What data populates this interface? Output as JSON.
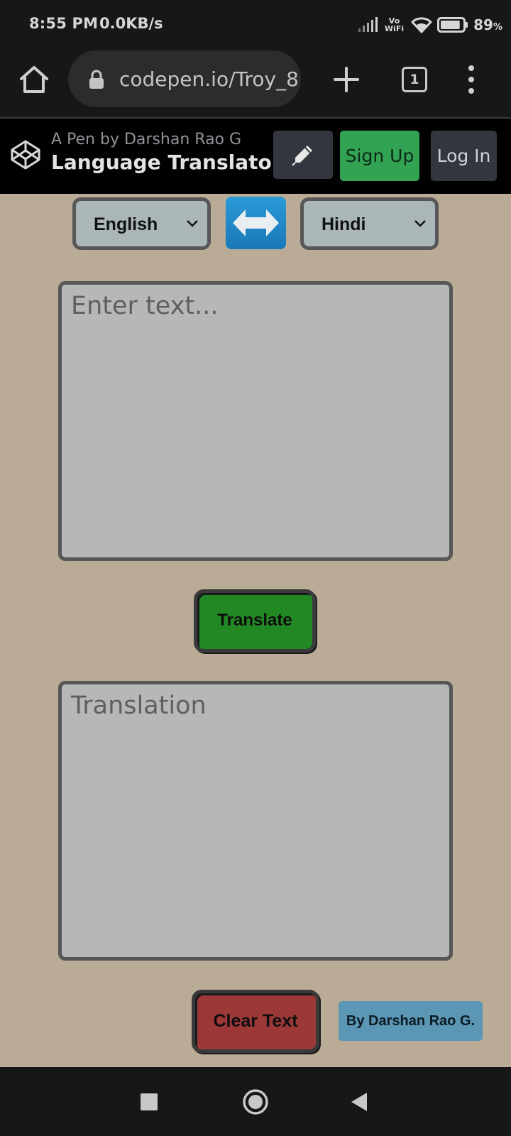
{
  "status_bar": {
    "time": "8:55 PM",
    "network_speed": "0.0KB/s",
    "wifi_label_top": "Vo",
    "wifi_label_bottom": "WiFi",
    "battery_percent": "89",
    "battery_unit": "%",
    "battery_level": 0.89
  },
  "browser": {
    "url": "codepen.io/Troy_8",
    "tab_count": "1"
  },
  "pen_header": {
    "byline": "A Pen by Darshan Rao G",
    "title": "Language Translator",
    "sign_up_label": "Sign Up",
    "log_in_label": "Log In"
  },
  "translator": {
    "source_language": "English",
    "target_language": "Hindi",
    "input_placeholder": "Enter text...",
    "output_placeholder": "Translation",
    "translate_label": "Translate",
    "clear_label": "Clear Text",
    "author_label": "By Darshan Rao G."
  },
  "colors": {
    "app_background": "#b9ab96",
    "translate_button": "#228823",
    "clear_button": "#9d3839",
    "sign_up_button": "#32a253",
    "author_badge": "#5b96b5"
  },
  "icons": {
    "home": "home-icon",
    "lock": "lock-icon",
    "new_tab": "plus-icon",
    "menu": "more-vertical-icon",
    "codepen": "codepen-logo-icon",
    "edit": "pencil-icon",
    "swap": "left-right-arrow-icon",
    "nav_recent": "square-icon",
    "nav_home": "circle-icon",
    "nav_back": "triangle-back-icon"
  }
}
